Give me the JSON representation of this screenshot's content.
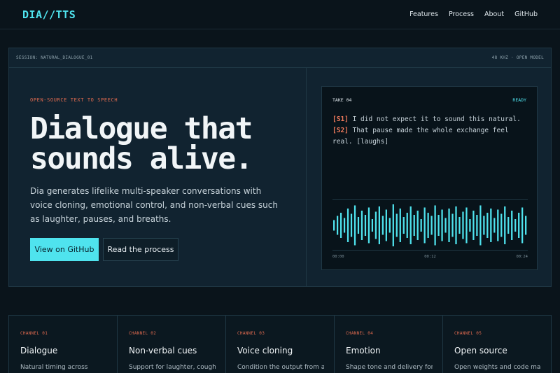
{
  "nav": {
    "logo": "DIA//TTS",
    "links": [
      "Features",
      "Process",
      "About",
      "GitHub"
    ]
  },
  "hero": {
    "session": "SESSION: NATURAL_DIALOGUE_01",
    "meta": "48 KHZ · OPEN MODEL",
    "eyebrow": "OPEN-SOURCE TEXT TO SPEECH",
    "headline_line1": "Dialogue that",
    "headline_line2": "sounds alive.",
    "description": "Dia generates lifelike multi-speaker conversations with voice cloning, emotional control, and non-verbal cues such as laughter, pauses, and breaths.",
    "primary_button": "View on GitHub",
    "secondary_button": "Read the process"
  },
  "player": {
    "take": "TAKE 04",
    "status": "READY",
    "lines": [
      {
        "speaker": "[S1]",
        "text": " I did not expect it to sound this natural."
      },
      {
        "speaker": "[S2]",
        "text": " That pause made the whole exchange feel real. [laughs]"
      }
    ],
    "times": [
      "00:00",
      "00:12",
      "00:24"
    ],
    "wave_levels": [
      0.25,
      0.45,
      0.6,
      0.35,
      0.8,
      0.55,
      0.95,
      0.4,
      0.7,
      0.5,
      0.85,
      0.3,
      0.65,
      0.9,
      0.45,
      0.75,
      0.35,
      1.0,
      0.55,
      0.8,
      0.4,
      0.6,
      0.9,
      0.5,
      0.7,
      0.3,
      0.85,
      0.6,
      0.45,
      0.95,
      0.5,
      0.75,
      0.35,
      0.8,
      0.55,
      0.9,
      0.4,
      0.65,
      0.85,
      0.3,
      0.7,
      0.5,
      0.95,
      0.45,
      0.6,
      0.8,
      0.35,
      0.75,
      0.55,
      0.9,
      0.4,
      0.7,
      0.3,
      0.6,
      0.85,
      0.45
    ],
    "wave_color": "#4fe3ee"
  },
  "cards": [
    {
      "tag": "CHANNEL 01",
      "title": "Dialogue",
      "text": "Natural timing across"
    },
    {
      "tag": "CHANNEL 02",
      "title": "Non-verbal cues",
      "text": "Support for laughter, coughs,"
    },
    {
      "tag": "CHANNEL 03",
      "title": "Voice cloning",
      "text": "Condition the output from a"
    },
    {
      "tag": "CHANNEL 04",
      "title": "Emotion",
      "text": "Shape tone and delivery for"
    },
    {
      "tag": "CHANNEL 05",
      "title": "Open source",
      "text": "Open weights and code make"
    }
  ]
}
